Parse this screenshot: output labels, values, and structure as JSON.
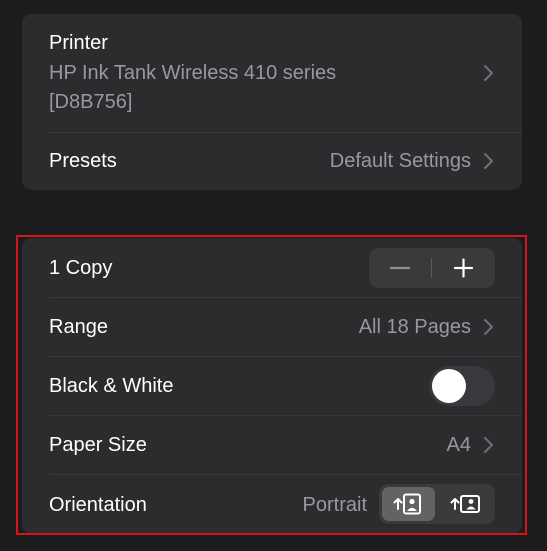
{
  "printer": {
    "label": "Printer",
    "name_line1": "HP Ink Tank Wireless 410 series",
    "name_line2": "[D8B756]"
  },
  "presets": {
    "label": "Presets",
    "value": "Default Settings"
  },
  "copies": {
    "label": "1 Copy",
    "count": 1
  },
  "range": {
    "label": "Range",
    "value": "All 18 Pages"
  },
  "black_white": {
    "label": "Black & White",
    "enabled": false
  },
  "paper_size": {
    "label": "Paper Size",
    "value": "A4"
  },
  "orientation": {
    "label": "Orientation",
    "value": "Portrait",
    "options": [
      "portrait",
      "landscape"
    ],
    "selected": "portrait"
  },
  "colors": {
    "background": "#1c1c1e",
    "card": "#2c2c2e",
    "highlight": "#d3141b",
    "secondary_text": "#98989f"
  }
}
